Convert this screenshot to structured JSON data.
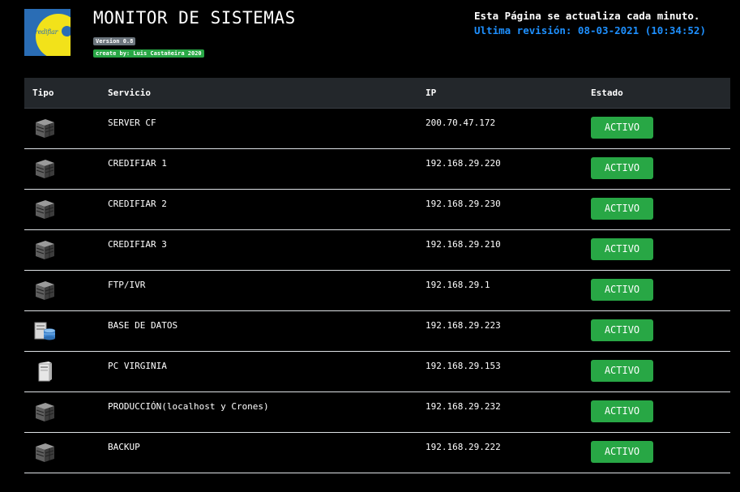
{
  "header": {
    "logo_text": "credifiar",
    "title": "MONITOR DE SISTEMAS",
    "version": "Version 0.8",
    "author": "create by: Luis Castañeira 2020",
    "refresh_notice": "Esta Página se actualiza cada minuto.",
    "last_revision_label": "Ultima revisión: 08-03-2021 (10:34:52)"
  },
  "table": {
    "columns": [
      "Tipo",
      "Servicio",
      "IP",
      "Estado"
    ],
    "rows": [
      {
        "icon": "server-icon",
        "service": "SERVER CF",
        "ip": "200.70.47.172",
        "status": "ACTIVO"
      },
      {
        "icon": "server-icon",
        "service": "CREDIFIAR 1",
        "ip": "192.168.29.220",
        "status": "ACTIVO"
      },
      {
        "icon": "server-icon",
        "service": "CREDIFIAR 2",
        "ip": "192.168.29.230",
        "status": "ACTIVO"
      },
      {
        "icon": "server-icon",
        "service": "CREDIFIAR 3",
        "ip": "192.168.29.210",
        "status": "ACTIVO"
      },
      {
        "icon": "server-icon",
        "service": "FTP/IVR",
        "ip": "192.168.29.1",
        "status": "ACTIVO"
      },
      {
        "icon": "database-icon",
        "service": "BASE DE DATOS",
        "ip": "192.168.29.223",
        "status": "ACTIVO"
      },
      {
        "icon": "pc-tower-icon",
        "service": "PC VIRGINIA",
        "ip": "192.168.29.153",
        "status": "ACTIVO"
      },
      {
        "icon": "server-icon",
        "service": "PRODUCCIÓN(localhost y Crones)",
        "ip": "192.168.29.232",
        "status": "ACTIVO"
      },
      {
        "icon": "server-icon",
        "service": "BACKUP",
        "ip": "192.168.29.222",
        "status": "ACTIVO"
      }
    ]
  },
  "colors": {
    "background": "#000000",
    "header_row": "#23272b",
    "status_active": "#28a745",
    "revision_text": "#1e90ff",
    "version_badge": "#6c757d"
  }
}
